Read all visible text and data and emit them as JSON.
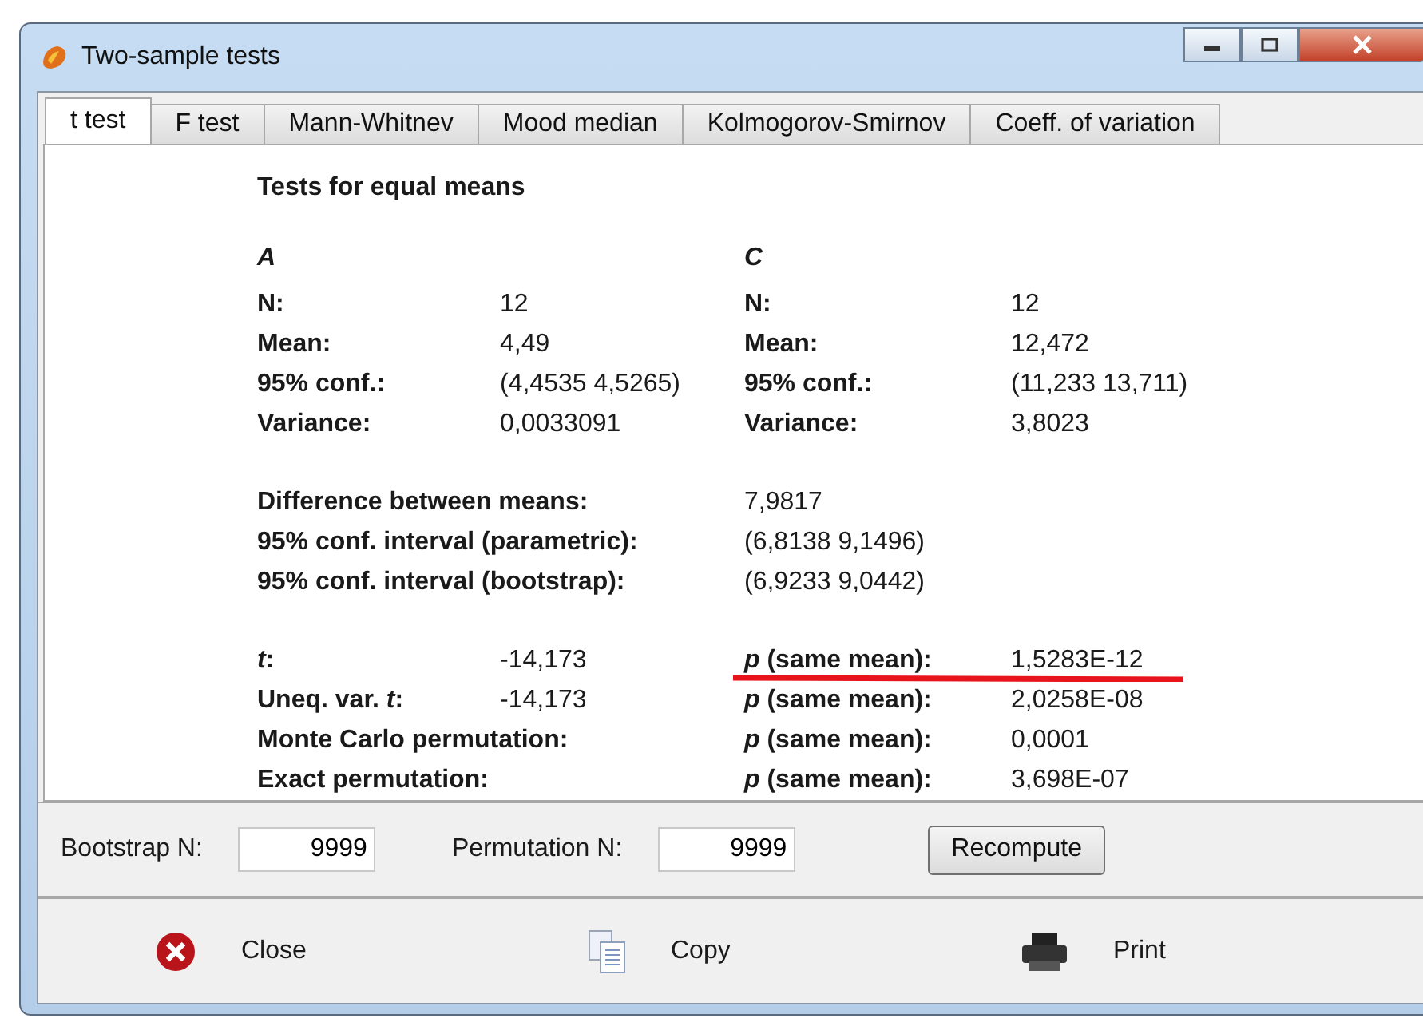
{
  "window": {
    "title": "Two-sample tests"
  },
  "tabs": [
    {
      "label": "t test",
      "selected": true
    },
    {
      "label": "F test",
      "selected": false
    },
    {
      "label": "Mann-Whitnev",
      "selected": false
    },
    {
      "label": "Mood median",
      "selected": false
    },
    {
      "label": "Kolmogorov-Smirnov",
      "selected": false
    },
    {
      "label": "Coeff. of variation",
      "selected": false
    }
  ],
  "heading": "Tests for equal means",
  "samples": [
    {
      "name": "A",
      "rows": [
        {
          "label": "N:",
          "value": "12"
        },
        {
          "label": "Mean:",
          "value": "4,49"
        },
        {
          "label": "95% conf.:",
          "value": "(4,4535 4,5265)"
        },
        {
          "label": "Variance:",
          "value": "0,0033091"
        }
      ]
    },
    {
      "name": "C",
      "rows": [
        {
          "label": "N:",
          "value": "12"
        },
        {
          "label": "Mean:",
          "value": "12,472"
        },
        {
          "label": "95% conf.:",
          "value": "(11,233 13,711)"
        },
        {
          "label": "Variance:",
          "value": "3,8023"
        }
      ]
    }
  ],
  "differences": [
    {
      "label": "Difference between means:",
      "value": "7,9817"
    },
    {
      "label": "95% conf. interval (parametric):",
      "value": "(6,8138 9,1496)"
    },
    {
      "label": "95% conf. interval (bootstrap):",
      "value": "(6,9233 9,0442)"
    }
  ],
  "tests": [
    {
      "label": "*t*:",
      "statistic": "-14,173",
      "p_label": "*p* (same mean):",
      "p_value": "1,5283E-12",
      "underlined": true
    },
    {
      "label": "Uneq. var. *t*:",
      "statistic": "-14,173",
      "p_label": "*p* (same mean):",
      "p_value": "2,0258E-08",
      "underlined": false
    },
    {
      "label": "Monte Carlo permutation:",
      "p_label": "*p* (same mean):",
      "p_value": "0,0001",
      "underlined": false
    },
    {
      "label": "Exact permutation:",
      "p_label": "*p* (same mean):",
      "p_value": "3,698E-07",
      "underlined": false
    }
  ],
  "parameters": [
    {
      "label": "Bootstrap N:",
      "value": "9999"
    },
    {
      "label": "Permutation N:",
      "value": "9999"
    }
  ],
  "recompute_button": "Recompute",
  "actions": [
    {
      "kind": "close",
      "label": "Close"
    },
    {
      "kind": "copy",
      "label": "Copy"
    },
    {
      "kind": "print",
      "label": "Print"
    }
  ]
}
